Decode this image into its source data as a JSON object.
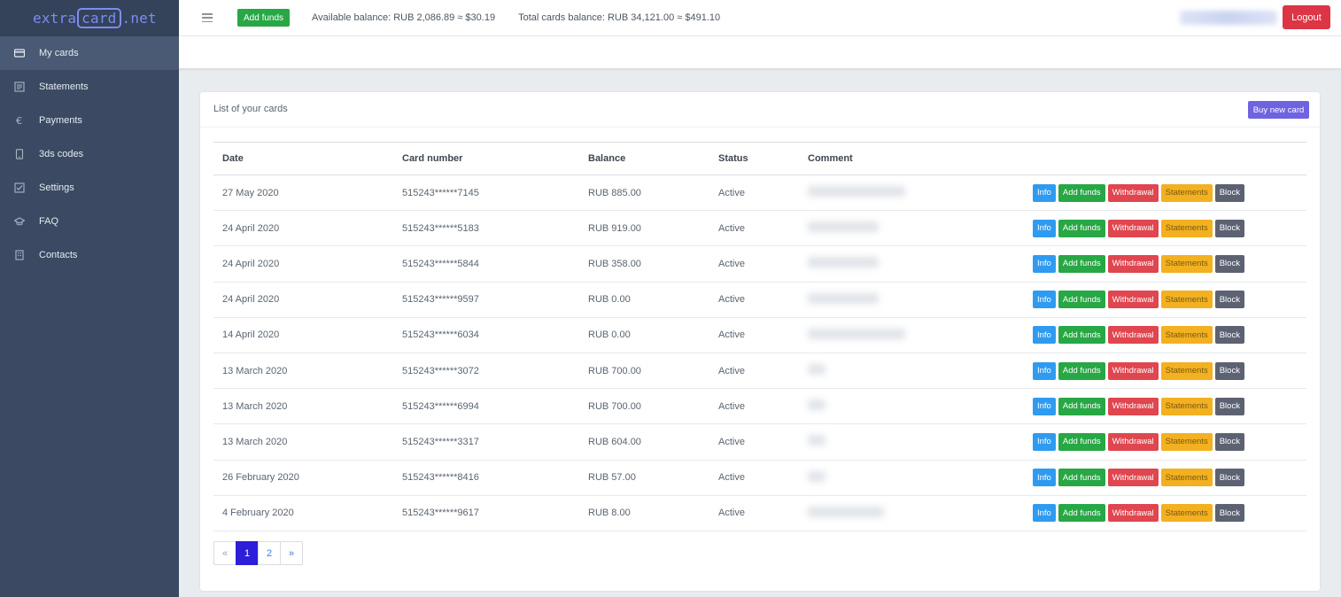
{
  "logo": {
    "prefix": "extra",
    "boxed": "card",
    "suffix": ".net"
  },
  "sidebar": {
    "items": [
      {
        "label": "My cards",
        "icon": "card-icon",
        "active": true
      },
      {
        "label": "Statements",
        "icon": "document-icon"
      },
      {
        "label": "Payments",
        "icon": "euro-icon"
      },
      {
        "label": "3ds codes",
        "icon": "phone-icon"
      },
      {
        "label": "Settings",
        "icon": "checkbox-icon"
      },
      {
        "label": "FAQ",
        "icon": "graduation-icon"
      },
      {
        "label": "Contacts",
        "icon": "building-icon"
      }
    ]
  },
  "header": {
    "add_funds_label": "Add funds",
    "available_balance": "Available balance: RUB 2,086.89 ≈ $30.19",
    "total_cards_balance": "Total cards balance:  RUB 34,121.00 ≈  $491.10",
    "logout_label": "Logout"
  },
  "cards_panel": {
    "title": "List of your cards",
    "buy_label": "Buy new card",
    "columns": [
      "Date",
      "Card number",
      "Balance",
      "Status",
      "Comment"
    ],
    "action_labels": {
      "info": "Info",
      "add_funds": "Add funds",
      "withdrawal": "Withdrawal",
      "statements": "Statements",
      "block": "Block"
    },
    "rows": [
      {
        "date": "27 May 2020",
        "card": "515243******7145",
        "balance": "RUB 885.00",
        "status": "Active"
      },
      {
        "date": "24 April 2020",
        "card": "515243******5183",
        "balance": "RUB 919.00",
        "status": "Active"
      },
      {
        "date": "24 April 2020",
        "card": "515243******5844",
        "balance": "RUB 358.00",
        "status": "Active"
      },
      {
        "date": "24 April 2020",
        "card": "515243******9597",
        "balance": "RUB 0.00",
        "status": "Active"
      },
      {
        "date": "14 April 2020",
        "card": "515243******6034",
        "balance": "RUB 0.00",
        "status": "Active"
      },
      {
        "date": "13 March 2020",
        "card": "515243******3072",
        "balance": "RUB 700.00",
        "status": "Active"
      },
      {
        "date": "13 March 2020",
        "card": "515243******6994",
        "balance": "RUB 700.00",
        "status": "Active"
      },
      {
        "date": "13 March 2020",
        "card": "515243******3317",
        "balance": "RUB 604.00",
        "status": "Active"
      },
      {
        "date": "26 February 2020",
        "card": "515243******8416",
        "balance": "RUB 57.00",
        "status": "Active"
      },
      {
        "date": "4 February 2020",
        "card": "515243******9617",
        "balance": "RUB 8.00",
        "status": "Active"
      }
    ]
  },
  "pagination": {
    "prev": "«",
    "pages": [
      "1",
      "2"
    ],
    "current": "1",
    "next": "»"
  },
  "colors": {
    "sidebar": "#3b4a62",
    "accent": "#7b8df0",
    "green": "#28a745",
    "red": "#dc3545",
    "purple": "#6f63e0"
  }
}
